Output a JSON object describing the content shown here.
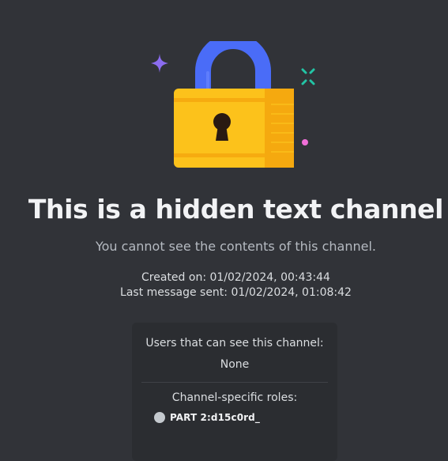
{
  "channel": {
    "title": "This is a hidden text channel",
    "subtitle": "You cannot see the contents of this channel.",
    "created_on": "Created on: 01/02/2024, 00:43:44",
    "last_message": "Last message sent: 01/02/2024, 01:08:42"
  },
  "access": {
    "users_heading": "Users that can see this channel:",
    "users_value": "None",
    "roles_heading": "Channel-specific roles:",
    "roles": [
      {
        "name": "PART 2:d15c0rd_",
        "color": "#c4c9ce"
      }
    ]
  },
  "colors": {
    "background": "#313338",
    "panel": "#2b2d31",
    "lock_body": "#fcc21b",
    "lock_shackle": "#4a6cf7",
    "sparkle_purple": "#8b6cf0",
    "sparkle_teal": "#23c4a5",
    "sparkle_pink": "#f06fd8"
  },
  "icons": {
    "illustration": "padlock-icon"
  }
}
